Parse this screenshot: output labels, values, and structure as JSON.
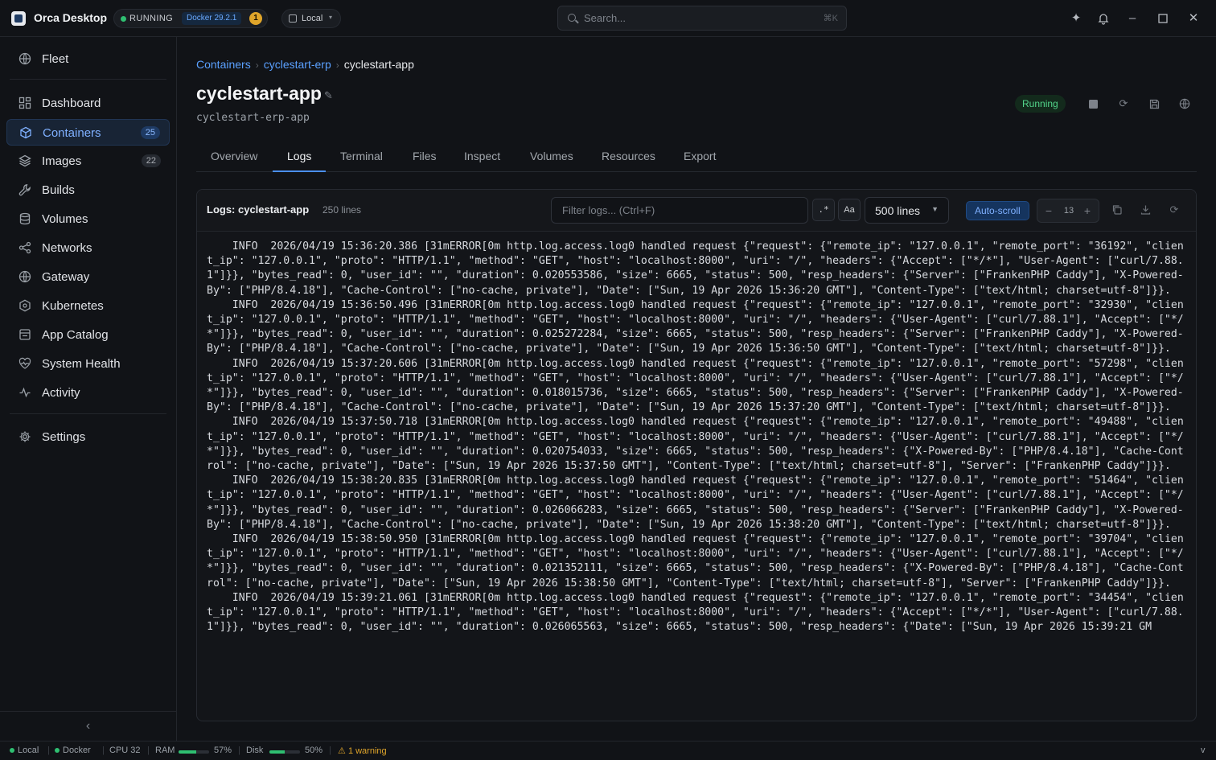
{
  "app": {
    "title": "Orca Desktop",
    "status": "RUNNING",
    "docker_version": "Docker 29.2.1",
    "warning_count": "1",
    "context": "Local"
  },
  "search": {
    "placeholder": "Search...",
    "shortcut": "⌘K"
  },
  "topbar_icons": [
    "sparkle-icon",
    "bell-icon",
    "minimize-icon",
    "maximize-icon",
    "close-icon"
  ],
  "sidebar": {
    "items": [
      {
        "label": "Fleet",
        "icon": "globe-icon"
      },
      {
        "label": "Dashboard",
        "icon": "dashboard-icon"
      },
      {
        "label": "Containers",
        "icon": "cube-icon",
        "count": "25",
        "active": true
      },
      {
        "label": "Images",
        "icon": "layers-icon",
        "count": "22"
      },
      {
        "label": "Builds",
        "icon": "wrench-icon"
      },
      {
        "label": "Volumes",
        "icon": "database-icon"
      },
      {
        "label": "Networks",
        "icon": "share-icon"
      },
      {
        "label": "Gateway",
        "icon": "globe-icon"
      },
      {
        "label": "Kubernetes",
        "icon": "hexagon-icon"
      },
      {
        "label": "App Catalog",
        "icon": "store-icon"
      },
      {
        "label": "System Health",
        "icon": "heart-pulse-icon"
      },
      {
        "label": "Activity",
        "icon": "activity-icon"
      },
      {
        "label": "Settings",
        "icon": "gear-icon"
      }
    ]
  },
  "breadcrumb": {
    "root": "Containers",
    "parent": "cyclestart-erp",
    "current": "cyclestart-app"
  },
  "container": {
    "name": "cyclestart-app",
    "full_name": "cyclestart-erp-app",
    "state": "Running"
  },
  "tabs": [
    "Overview",
    "Logs",
    "Terminal",
    "Files",
    "Inspect",
    "Volumes",
    "Resources",
    "Export"
  ],
  "active_tab": "Logs",
  "logs": {
    "title": "Logs: cyclestart-app",
    "line_count": "250 lines",
    "filter_placeholder": "Filter logs... (Ctrl+F)",
    "regex_label": ".*",
    "case_label": "Aa",
    "lines_option": "500 lines",
    "autoscroll_label": "Auto-scroll",
    "font_size": "13",
    "lines": [
      "    INFO  2026/04/19 15:36:20.386 [31mERROR[0m http.log.access.log0 handled request {\"request\": {\"remote_ip\": \"127.0.0.1\", \"remote_port\": \"36192\", \"client_ip\": \"127.0.0.1\", \"proto\": \"HTTP/1.1\", \"method\": \"GET\", \"host\": \"localhost:8000\", \"uri\": \"/\", \"headers\": {\"Accept\": [\"*/*\"], \"User-Agent\": [\"curl/7.88.1\"]}}, \"bytes_read\": 0, \"user_id\": \"\", \"duration\": 0.020553586, \"size\": 6665, \"status\": 500, \"resp_headers\": {\"Server\": [\"FrankenPHP Caddy\"], \"X-Powered-By\": [\"PHP/8.4.18\"], \"Cache-Control\": [\"no-cache, private\"], \"Date\": [\"Sun, 19 Apr 2026 15:36:20 GMT\"], \"Content-Type\": [\"text/html; charset=utf-8\"]}}.",
      "    INFO  2026/04/19 15:36:50.496 [31mERROR[0m http.log.access.log0 handled request {\"request\": {\"remote_ip\": \"127.0.0.1\", \"remote_port\": \"32930\", \"client_ip\": \"127.0.0.1\", \"proto\": \"HTTP/1.1\", \"method\": \"GET\", \"host\": \"localhost:8000\", \"uri\": \"/\", \"headers\": {\"User-Agent\": [\"curl/7.88.1\"], \"Accept\": [\"*/*\"]}}, \"bytes_read\": 0, \"user_id\": \"\", \"duration\": 0.025272284, \"size\": 6665, \"status\": 500, \"resp_headers\": {\"Server\": [\"FrankenPHP Caddy\"], \"X-Powered-By\": [\"PHP/8.4.18\"], \"Cache-Control\": [\"no-cache, private\"], \"Date\": [\"Sun, 19 Apr 2026 15:36:50 GMT\"], \"Content-Type\": [\"text/html; charset=utf-8\"]}}.",
      "    INFO  2026/04/19 15:37:20.606 [31mERROR[0m http.log.access.log0 handled request {\"request\": {\"remote_ip\": \"127.0.0.1\", \"remote_port\": \"57298\", \"client_ip\": \"127.0.0.1\", \"proto\": \"HTTP/1.1\", \"method\": \"GET\", \"host\": \"localhost:8000\", \"uri\": \"/\", \"headers\": {\"User-Agent\": [\"curl/7.88.1\"], \"Accept\": [\"*/*\"]}}, \"bytes_read\": 0, \"user_id\": \"\", \"duration\": 0.018015736, \"size\": 6665, \"status\": 500, \"resp_headers\": {\"Server\": [\"FrankenPHP Caddy\"], \"X-Powered-By\": [\"PHP/8.4.18\"], \"Cache-Control\": [\"no-cache, private\"], \"Date\": [\"Sun, 19 Apr 2026 15:37:20 GMT\"], \"Content-Type\": [\"text/html; charset=utf-8\"]}}.",
      "    INFO  2026/04/19 15:37:50.718 [31mERROR[0m http.log.access.log0 handled request {\"request\": {\"remote_ip\": \"127.0.0.1\", \"remote_port\": \"49488\", \"client_ip\": \"127.0.0.1\", \"proto\": \"HTTP/1.1\", \"method\": \"GET\", \"host\": \"localhost:8000\", \"uri\": \"/\", \"headers\": {\"User-Agent\": [\"curl/7.88.1\"], \"Accept\": [\"*/*\"]}}, \"bytes_read\": 0, \"user_id\": \"\", \"duration\": 0.020754033, \"size\": 6665, \"status\": 500, \"resp_headers\": {\"X-Powered-By\": [\"PHP/8.4.18\"], \"Cache-Control\": [\"no-cache, private\"], \"Date\": [\"Sun, 19 Apr 2026 15:37:50 GMT\"], \"Content-Type\": [\"text/html; charset=utf-8\"], \"Server\": [\"FrankenPHP Caddy\"]}}.",
      "    INFO  2026/04/19 15:38:20.835 [31mERROR[0m http.log.access.log0 handled request {\"request\": {\"remote_ip\": \"127.0.0.1\", \"remote_port\": \"51464\", \"client_ip\": \"127.0.0.1\", \"proto\": \"HTTP/1.1\", \"method\": \"GET\", \"host\": \"localhost:8000\", \"uri\": \"/\", \"headers\": {\"User-Agent\": [\"curl/7.88.1\"], \"Accept\": [\"*/*\"]}}, \"bytes_read\": 0, \"user_id\": \"\", \"duration\": 0.026066283, \"size\": 6665, \"status\": 500, \"resp_headers\": {\"Server\": [\"FrankenPHP Caddy\"], \"X-Powered-By\": [\"PHP/8.4.18\"], \"Cache-Control\": [\"no-cache, private\"], \"Date\": [\"Sun, 19 Apr 2026 15:38:20 GMT\"], \"Content-Type\": [\"text/html; charset=utf-8\"]}}.",
      "    INFO  2026/04/19 15:38:50.950 [31mERROR[0m http.log.access.log0 handled request {\"request\": {\"remote_ip\": \"127.0.0.1\", \"remote_port\": \"39704\", \"client_ip\": \"127.0.0.1\", \"proto\": \"HTTP/1.1\", \"method\": \"GET\", \"host\": \"localhost:8000\", \"uri\": \"/\", \"headers\": {\"User-Agent\": [\"curl/7.88.1\"], \"Accept\": [\"*/*\"]}}, \"bytes_read\": 0, \"user_id\": \"\", \"duration\": 0.021352111, \"size\": 6665, \"status\": 500, \"resp_headers\": {\"X-Powered-By\": [\"PHP/8.4.18\"], \"Cache-Control\": [\"no-cache, private\"], \"Date\": [\"Sun, 19 Apr 2026 15:38:50 GMT\"], \"Content-Type\": [\"text/html; charset=utf-8\"], \"Server\": [\"FrankenPHP Caddy\"]}}.",
      "    INFO  2026/04/19 15:39:21.061 [31mERROR[0m http.log.access.log0 handled request {\"request\": {\"remote_ip\": \"127.0.0.1\", \"remote_port\": \"34454\", \"client_ip\": \"127.0.0.1\", \"proto\": \"HTTP/1.1\", \"method\": \"GET\", \"host\": \"localhost:8000\", \"uri\": \"/\", \"headers\": {\"Accept\": [\"*/*\"], \"User-Agent\": [\"curl/7.88.1\"]}}, \"bytes_read\": 0, \"user_id\": \"\", \"duration\": 0.026065563, \"size\": 6665, \"status\": 500, \"resp_headers\": {\"Date\": [\"Sun, 19 Apr 2026 15:39:21 GM"
    ]
  },
  "statusbar": {
    "local": "Local",
    "docker": "Docker",
    "cpu": "CPU 32",
    "ram_label": "RAM",
    "ram_pct": "57%",
    "ram_fraction": 0.57,
    "disk_label": "Disk",
    "disk_pct": "50%",
    "disk_fraction": 0.5,
    "warnings": "1 warning",
    "version": "v"
  },
  "colors": {
    "accent": "#4b8ff5",
    "running": "#52d48a",
    "warning": "#e0a52a",
    "background": "#111317"
  }
}
